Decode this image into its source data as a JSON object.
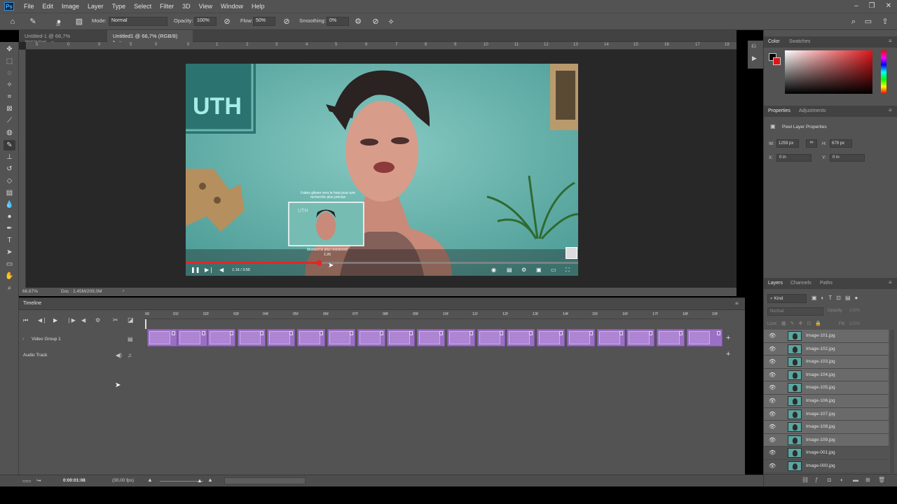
{
  "app": {
    "logo": "Ps"
  },
  "menu": [
    "File",
    "Edit",
    "Image",
    "Layer",
    "Type",
    "Select",
    "Filter",
    "3D",
    "View",
    "Window",
    "Help"
  ],
  "window_controls": [
    "–",
    "❐",
    "✕"
  ],
  "options": {
    "brush_size": "20",
    "mode_label": "Mode:",
    "mode_value": "Normal",
    "opacity_label": "Opacity:",
    "opacity_value": "100%",
    "flow_label": "Flow:",
    "flow_value": "50%",
    "smoothing_label": "Smoothing:",
    "smoothing_value": "0%"
  },
  "doc_tabs": [
    {
      "label": "Untitled-1 @ 66,7% (RGB/8#)",
      "close": "×"
    },
    {
      "label": "Untitled1 @ 66,7% (RGB/8) *",
      "close": "×"
    }
  ],
  "rulers": {
    "top": [
      "5",
      "0",
      "1",
      "2",
      "3",
      "4",
      "5",
      "6",
      "7",
      "8",
      "9",
      "10",
      "11",
      "12",
      "13",
      "14",
      "15",
      "16",
      "17",
      "18"
    ]
  },
  "image": {
    "wall_sign": "UTH",
    "video_tooltip_line1": "Faites glisser vers le haut pour une",
    "video_tooltip_line2": "recherche plus précise",
    "most_replayed": "Moment le plus revisionné",
    "preview_time": "1:26",
    "time_display": "1:16 / 3:55",
    "progress": 0.34
  },
  "status": {
    "zoom": "66,67%",
    "doc": "Doc : 2,45M/209,0M",
    "arrow": "›"
  },
  "timeline": {
    "title": "Timeline",
    "ruler": [
      "00",
      "01f",
      "02f",
      "03f",
      "04f",
      "05f",
      "06f",
      "07f",
      "08f",
      "09f",
      "10f",
      "11f",
      "12f",
      "13f",
      "14f",
      "15f",
      "16f",
      "17f",
      "18f",
      "19f"
    ],
    "video_group": "Video Group 1",
    "audio_track": "Audio Track",
    "add": "+",
    "current_time": "0:00:01:08",
    "fps": "(30,00 fps)"
  },
  "color_panel": {
    "tabs": [
      "Color",
      "Swatches"
    ],
    "fg": "#000000",
    "bg": "#e0151a"
  },
  "properties": {
    "tabs": [
      "Properties",
      "Adjustments"
    ],
    "title": "Pixel Layer Properties",
    "w_label": "W:",
    "w_value": "1259 px",
    "h_label": "H:",
    "h_value": "679 px",
    "x_label": "X:",
    "x_value": "0 in",
    "y_label": "Y:",
    "y_value": "0 in"
  },
  "layers_panel": {
    "tabs": [
      "Layers",
      "Channels",
      "Paths"
    ],
    "kind": "Kind",
    "blend": "Normal",
    "opacity_label": "Opacity:",
    "opacity_value": "100%",
    "lock_label": "Lock:",
    "fill_label": "Fill:",
    "fill_value": "100%",
    "layers": [
      "Image-101.jpg",
      "Image-102.jpg",
      "Image-103.jpg",
      "Image-104.jpg",
      "Image-105.jpg",
      "Image-106.jpg",
      "Image-107.jpg",
      "Image-108.jpg",
      "Image-109.jpg",
      "Image-001.jpg",
      "Image-000.jpg"
    ]
  },
  "accent_colors": {
    "frame": "#9a6fc4",
    "progress": "#e32626"
  }
}
